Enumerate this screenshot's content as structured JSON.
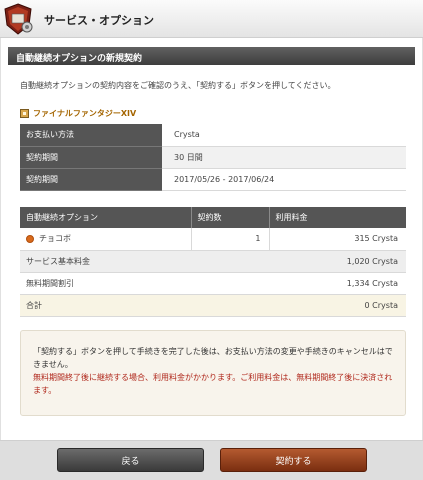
{
  "header": {
    "title": "サービス・オプション"
  },
  "section": {
    "title": "自動継続オプションの新規契約"
  },
  "intro": "自動継続オプションの契約内容をご確認のうえ、「契約する」ボタンを押してください。",
  "game": {
    "name": "ファイナルファンタジーXIV"
  },
  "info": [
    {
      "label": "お支払い方法",
      "value": "Crysta"
    },
    {
      "label": "契約期間",
      "value": "30 日間"
    },
    {
      "label": "契約期間",
      "value": "2017/05/26 - 2017/06/24"
    }
  ],
  "options": {
    "headers": [
      "自動継続オプション",
      "契約数",
      "利用料金"
    ],
    "item": {
      "name": "チョコボ",
      "count": "1",
      "price": "315 Crysta"
    },
    "service_fee": {
      "label": "サービス基本料金",
      "price": "1,020 Crysta"
    },
    "free_deduction": {
      "label": "無料期間割引",
      "price": "1,334 Crysta"
    },
    "total": {
      "label": "合計",
      "price": "0 Crysta"
    }
  },
  "notes": {
    "line1": "「契約する」ボタンを押して手続きを完了した後は、お支払い方法の変更や手続きのキャンセルはできません。",
    "line2": "無料期間終了後に継続する場合、利用料金がかかります。ご利用料金は、無料期間終了後に決済されます。"
  },
  "buttons": {
    "back": "戻る",
    "contract": "契約する"
  },
  "colors": {
    "header_bar": "#4a4a4a",
    "accent_orange": "#d96a1c",
    "warning_red": "#b0281c",
    "contract_button": "#8e3a17"
  }
}
